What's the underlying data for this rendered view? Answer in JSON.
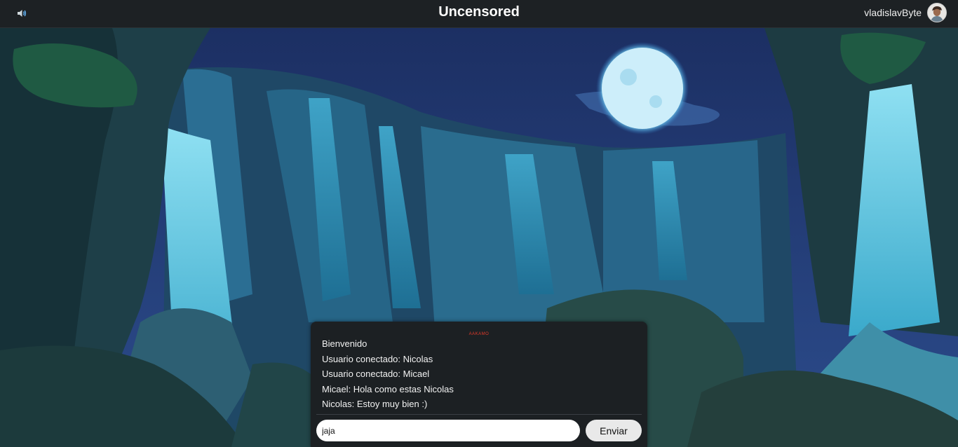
{
  "header": {
    "title": "Uncensored",
    "username": "vladislavByte",
    "sound_icon": "speaker-icon"
  },
  "chat": {
    "tag": "AAKAMO",
    "messages": [
      "Bienvenido",
      "Usuario conectado: Nicolas",
      "Usuario conectado: Micael",
      "Micael: Hola como estas Nicolas",
      "Nicolas: Estoy muy bien :)"
    ],
    "input_value": "jaja",
    "send_label": "Enviar"
  },
  "colors": {
    "topbar": "#1d2124",
    "chat_panel": "#1c2023",
    "tag": "#e23a2a"
  }
}
